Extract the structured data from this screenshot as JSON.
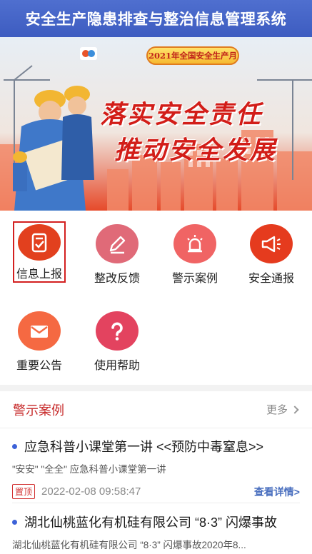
{
  "header": {
    "title": "安全生产隐患排查与整治信息管理系统"
  },
  "banner": {
    "badge": "2021年全国安全生产月",
    "line1": "落实安全责任",
    "line2": "推动安全发展",
    "dots": 2
  },
  "menu": [
    {
      "label": "信息上报",
      "icon": "report-check-icon",
      "color": "#e2401e",
      "selected": true
    },
    {
      "label": "整改反馈",
      "icon": "pencil-icon",
      "color": "#e06a78",
      "selected": false
    },
    {
      "label": "警示案例",
      "icon": "alarm-light-icon",
      "color": "#f06464",
      "selected": false
    },
    {
      "label": "安全通报",
      "icon": "megaphone-icon",
      "color": "#e53b1e",
      "selected": false
    },
    {
      "label": "重要公告",
      "icon": "mail-icon",
      "color": "#f56942",
      "selected": false
    },
    {
      "label": "使用帮助",
      "icon": "help-question-icon",
      "color": "#e3435f",
      "selected": false
    }
  ],
  "section": {
    "title": "警示案例",
    "more": "更多"
  },
  "news": [
    {
      "title": "应急科普小课堂第一讲 <<预防中毒窒息>>",
      "summary": "\"安安\" \"全全\" 应急科普小课堂第一讲",
      "tag": "置顶",
      "date": "2022-02-08 09:58:47",
      "detail": "查看详情>"
    },
    {
      "title": "湖北仙桃蓝化有机硅有限公司 “8·3” 闪爆事故",
      "summary": "湖北仙桃蓝化有机硅有限公司 “8·3” 闪爆事故2020年8..."
    }
  ]
}
